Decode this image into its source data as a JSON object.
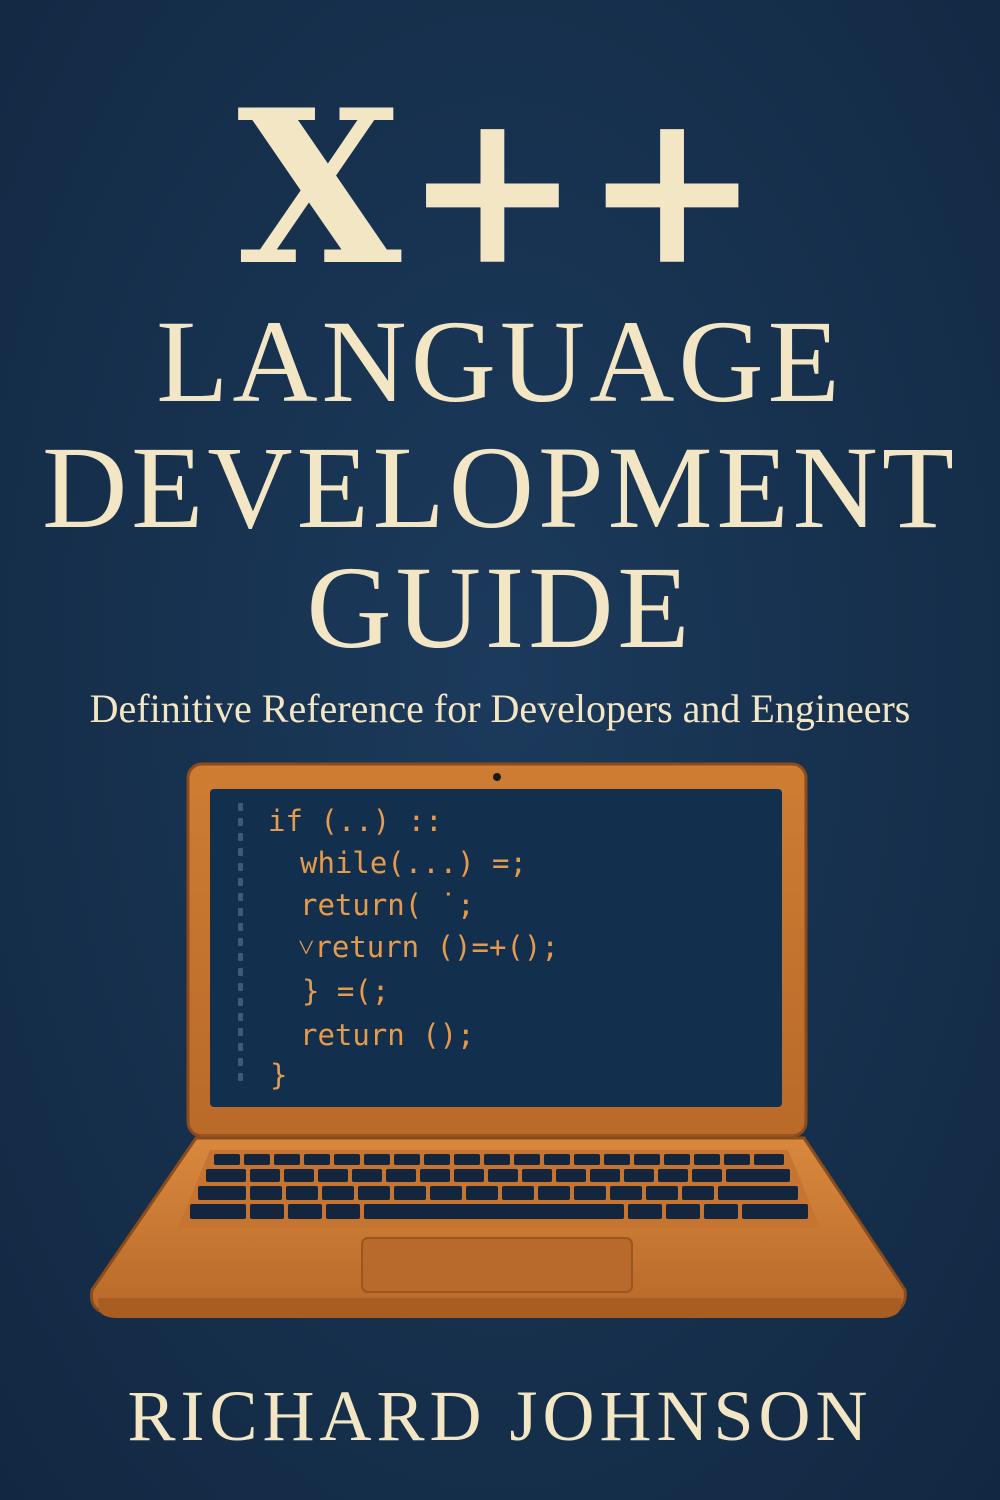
{
  "cover": {
    "title_main": "X++",
    "title_line1": "LANGUAGE",
    "title_line2": "DEVELOPMENT",
    "title_line3": "GUIDE",
    "subtitle": "Definitive Reference for Developers and Engineers",
    "author": "RICHARD JOHNSON"
  },
  "screen_code": [
    "if (..) ::",
    "while(...) =;",
    "return( ˙;",
    "˅return ()=+();",
    "} =(;",
    "return ();",
    "}"
  ],
  "colors": {
    "background": "#16304d",
    "title_text": "#f3e6c4",
    "laptop_body": "#c9772f",
    "screen": "#12304d",
    "code_text": "#e69a4c"
  }
}
